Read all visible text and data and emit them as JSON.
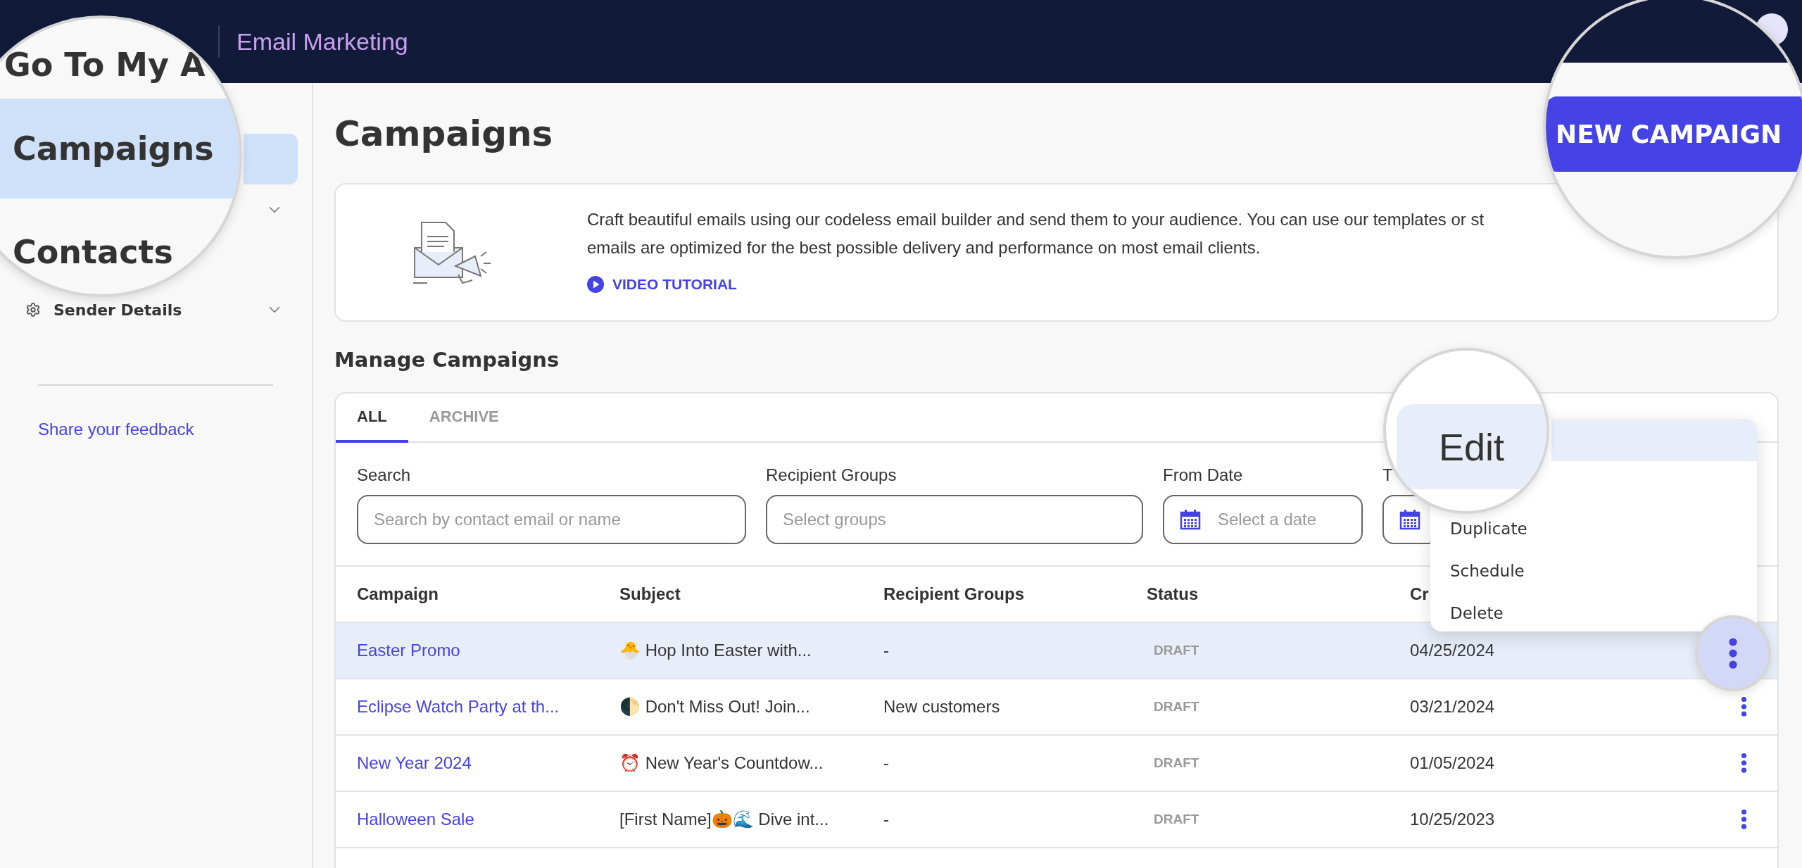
{
  "header": {
    "product": "Email Marketing"
  },
  "sidebar": {
    "items": [
      {
        "selected": true
      },
      {
        "selected": false,
        "expandable": true
      },
      {
        "label": "Sender Details",
        "selected": false,
        "expandable": true
      }
    ],
    "feedback_link": "Share your feedback"
  },
  "page": {
    "title": "Campaigns"
  },
  "intro": {
    "line_1": "Craft beautiful emails using our codeless email builder and send them to your audience. You can use our templates or st",
    "line_2": "emails are optimized for the best possible delivery and performance on most email clients.",
    "link": "VIDEO TUTORIAL"
  },
  "manage": {
    "heading": "Manage Campaigns",
    "tabs": [
      {
        "label": "ALL",
        "selected": true
      },
      {
        "label": "ARCHIVE",
        "selected": false
      }
    ],
    "filters": [
      {
        "label": "Search",
        "placeholder": "Search by contact email or name",
        "kind": "text"
      },
      {
        "label": "Recipient Groups",
        "placeholder": "Select groups",
        "kind": "text"
      },
      {
        "label": "From Date",
        "placeholder": "Select a date",
        "kind": "date"
      },
      {
        "label": "T",
        "kind": "date"
      }
    ],
    "columns": [
      "Campaign",
      "Subject",
      "Recipient Groups",
      "Status",
      "Cr"
    ],
    "rows": [
      {
        "campaign": "Easter Promo",
        "subject": "🐣 Hop Into Easter with...",
        "recipient_groups": "-",
        "status": "DRAFT",
        "created": "04/25/2024",
        "selected": true,
        "menu_open": true
      },
      {
        "campaign": "Eclipse Watch Party at th...",
        "subject": "🌓 Don't Miss Out! Join...",
        "recipient_groups": "New customers",
        "status": "DRAFT",
        "created": "03/21/2024",
        "selected": false,
        "menu_open": false
      },
      {
        "campaign": "New Year 2024",
        "subject": "⏰ New Year's Countdow...",
        "recipient_groups": "-",
        "status": "DRAFT",
        "created": "01/05/2024",
        "selected": false,
        "menu_open": false
      },
      {
        "campaign": "Halloween Sale",
        "subject": "[First Name]🎃🌊 Dive int...",
        "recipient_groups": "-",
        "status": "DRAFT",
        "created": "10/25/2023",
        "selected": false,
        "menu_open": false
      }
    ]
  },
  "row_menu": {
    "items": [
      {
        "selected": true
      },
      {
        "label": "Duplicate",
        "selected": false
      },
      {
        "label": "Schedule",
        "selected": false
      },
      {
        "label": "Delete",
        "selected": false
      }
    ]
  },
  "callouts": [
    {
      "kind": "sidebar",
      "items": [
        {
          "label": "Go To My A",
          "selected": false
        },
        {
          "label": "Campaigns",
          "selected": true
        },
        {
          "label": "Contacts",
          "selected": false
        }
      ]
    },
    {
      "kind": "button",
      "label": "NEW CAMPAIGN"
    },
    {
      "kind": "menu",
      "label": "Edit"
    }
  ]
}
